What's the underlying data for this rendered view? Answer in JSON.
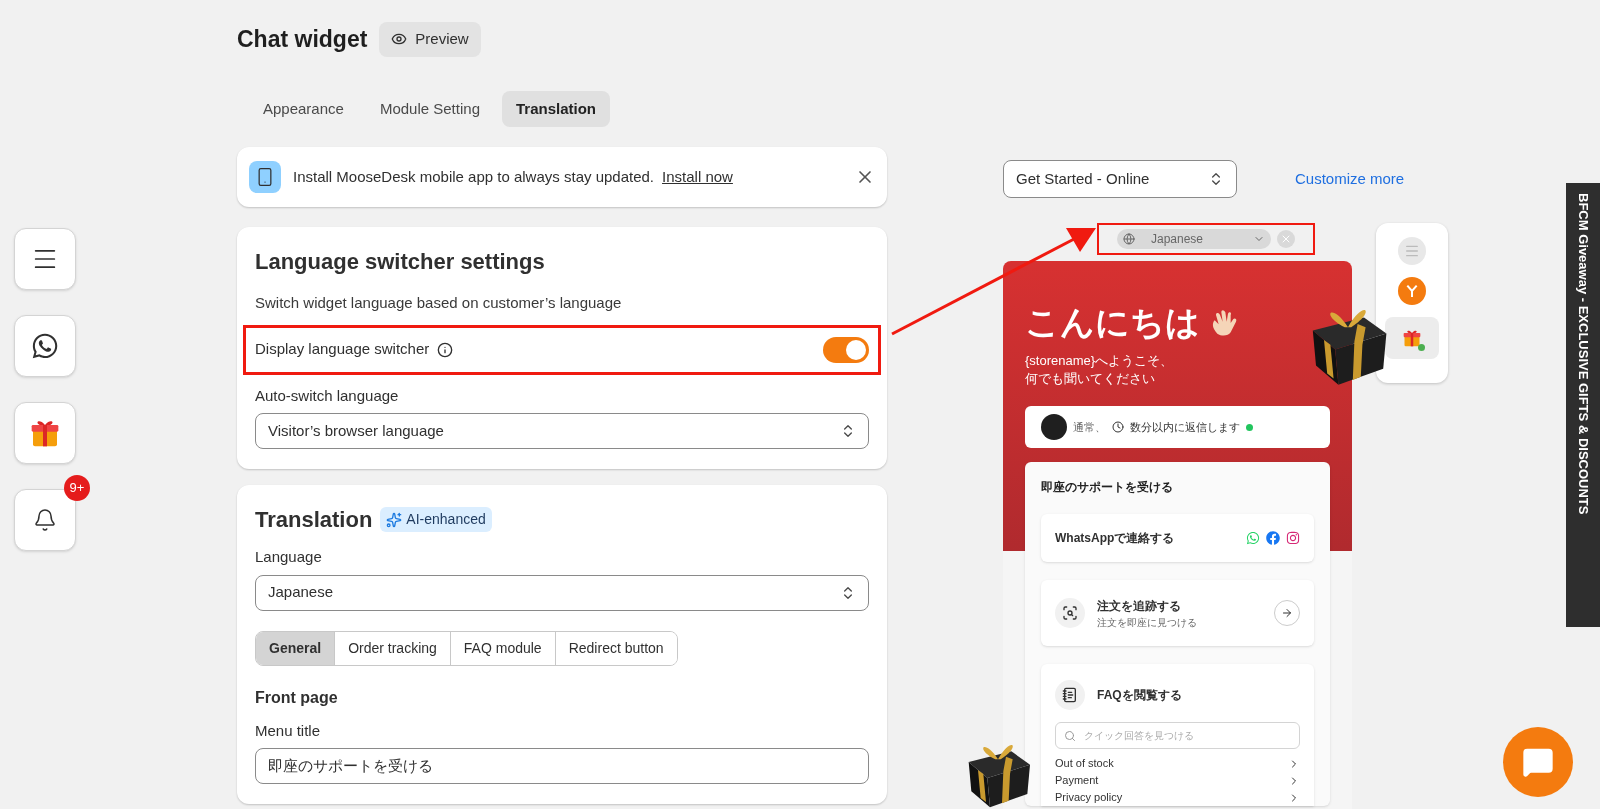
{
  "header": {
    "title": "Chat widget",
    "preview_button": "Preview"
  },
  "tabs": [
    {
      "label": "Appearance",
      "selected": false
    },
    {
      "label": "Module Setting",
      "selected": false
    },
    {
      "label": "Translation",
      "selected": true
    }
  ],
  "banner": {
    "text": "Install MooseDesk mobile app to always stay updated.",
    "link": "Install now"
  },
  "switcher_settings": {
    "title": "Language switcher settings",
    "description": "Switch widget language based on customer’s language",
    "display_switcher": {
      "label": "Display language switcher",
      "on": true
    },
    "auto_switch": {
      "label": "Auto-switch language",
      "value": "Visitor’s browser language"
    }
  },
  "translation": {
    "title": "Translation",
    "badge": "AI-enhanced",
    "language": {
      "label": "Language",
      "value": "Japanese"
    },
    "subtabs": [
      {
        "label": "General",
        "selected": true
      },
      {
        "label": "Order tracking",
        "selected": false
      },
      {
        "label": "FAQ module",
        "selected": false
      },
      {
        "label": "Redirect button",
        "selected": false
      }
    ],
    "section_title": "Front page",
    "menu_title": {
      "label": "Menu title",
      "value": "即座のサポートを受ける"
    }
  },
  "sidebar": {
    "notification_count": "9+"
  },
  "preview": {
    "page_select": "Get Started - Online",
    "customize_link": "Customize more",
    "language_pill": "Japanese",
    "greeting": "こんにちは",
    "subtitle_lines": [
      "{storename}へようこそ、",
      "何でも聞いてください"
    ],
    "status": {
      "prefix": "通常、",
      "reply_time": "数分以内に返信します",
      "online": true
    },
    "card_title": "即座のサポートを受ける",
    "contact": "WhatsAppで連絡する",
    "track": {
      "title": "注文を追跡する",
      "subtitle": "注文を即座に見つける"
    },
    "faq": {
      "title": "FAQを閲覧する",
      "search_placeholder": "クイック回答を見つける",
      "items": [
        "Out of stock",
        "Payment",
        "Privacy policy"
      ]
    }
  },
  "promo_tab": "BFCM Giveaway - EXCLUSIVE GIFTS & DISCOUNTS"
}
